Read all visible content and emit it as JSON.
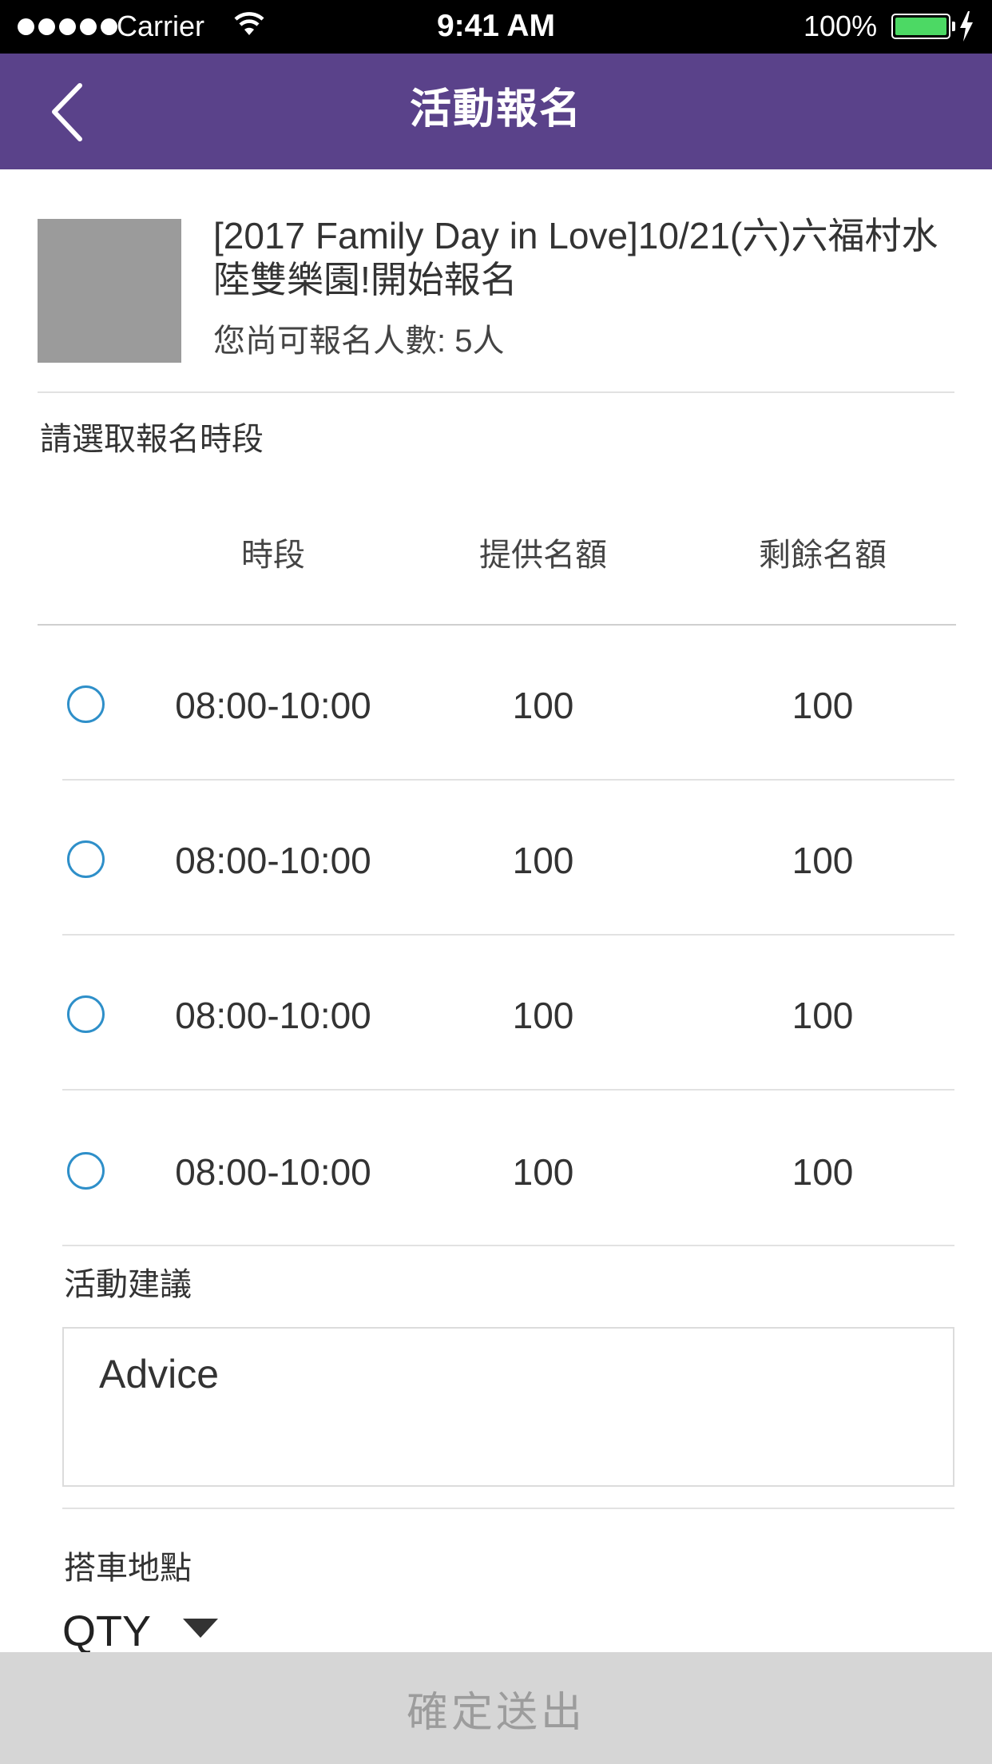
{
  "status_bar": {
    "carrier": "Carrier",
    "time": "9:41 AM",
    "battery": "100%"
  },
  "nav": {
    "title": "活動報名",
    "back_icon": "chevron-left-icon",
    "color": "#5a428a"
  },
  "event": {
    "title": "[2017 Family Day in Love]10/21(六)六福村水陸雙樂園!開始報名",
    "quota_label": "您尚可報名人數: ",
    "quota_value": "5人"
  },
  "slots": {
    "section_label": "請選取報名時段",
    "headers": [
      "時段",
      "提供名額",
      "剩餘名額"
    ],
    "rows": [
      {
        "time": "08:00-10:00",
        "offered": "100",
        "remaining": "100"
      },
      {
        "time": "08:00-10:00",
        "offered": "100",
        "remaining": "100"
      },
      {
        "time": "08:00-10:00",
        "offered": "100",
        "remaining": "100"
      },
      {
        "time": "08:00-10:00",
        "offered": "100",
        "remaining": "100"
      }
    ],
    "radio_color": "#2e8fc9"
  },
  "advice": {
    "label": "活動建議",
    "placeholder": "Advice"
  },
  "pickup": {
    "label": "搭車地點",
    "selected": "QTY"
  },
  "submit": {
    "label": "確定送出"
  }
}
